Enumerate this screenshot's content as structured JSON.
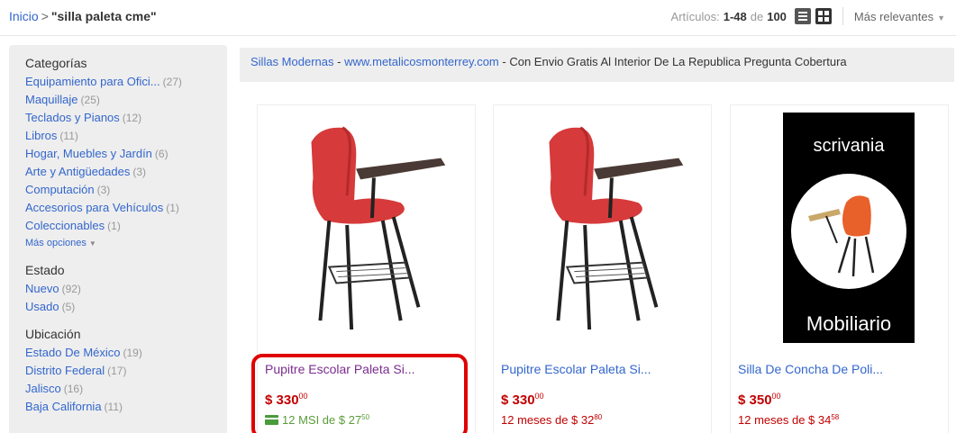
{
  "breadcrumb": {
    "home": "Inicio",
    "separator": ">",
    "query": "\"silla paleta cme\""
  },
  "results": {
    "prefix": "Artículos:",
    "range": "1-48",
    "de": "de",
    "total": "100",
    "sort_label": "Más relevantes"
  },
  "sidebar": {
    "categories": {
      "heading": "Categorías",
      "items": [
        {
          "label": "Equipamiento para Ofici...",
          "count": "(27)"
        },
        {
          "label": "Maquillaje",
          "count": "(25)"
        },
        {
          "label": "Teclados y Pianos",
          "count": "(12)"
        },
        {
          "label": "Libros",
          "count": "(11)"
        },
        {
          "label": "Hogar, Muebles y Jardín",
          "count": "(6)"
        },
        {
          "label": "Arte y Antigüedades",
          "count": "(3)"
        },
        {
          "label": "Computación",
          "count": "(3)"
        },
        {
          "label": "Accesorios para Vehículos",
          "count": "(1)"
        },
        {
          "label": "Coleccionables",
          "count": "(1)"
        }
      ],
      "more": "Más opciones"
    },
    "condition": {
      "heading": "Estado",
      "items": [
        {
          "label": "Nuevo",
          "count": "(92)"
        },
        {
          "label": "Usado",
          "count": "(5)"
        }
      ]
    },
    "location": {
      "heading": "Ubicación",
      "items": [
        {
          "label": "Estado De México",
          "count": "(19)"
        },
        {
          "label": "Distrito Federal",
          "count": "(17)"
        },
        {
          "label": "Jalisco",
          "count": "(16)"
        },
        {
          "label": "Baja California",
          "count": "(11)"
        }
      ]
    }
  },
  "ad": {
    "title": "Sillas Modernas",
    "dash1": " - ",
    "url": "www.metalicosmonterrey.com",
    "dash2": " - ",
    "description": "Con Envio Gratis Al Interior De La Republica Pregunta Cobertura"
  },
  "products": [
    {
      "title": "Pupitre Escolar Paleta Si...",
      "currency": "$",
      "price": "330",
      "cents": "00",
      "installment_text": "12 MSI de $ 27",
      "installment_cents": "50",
      "installment_style": "msi"
    },
    {
      "title": "Pupitre Escolar Paleta Si...",
      "currency": "$",
      "price": "330",
      "cents": "00",
      "installment_text": "12 meses de $ 32",
      "installment_cents": "80",
      "installment_style": "regular"
    },
    {
      "title": "Silla De Concha De Poli...",
      "currency": "$",
      "price": "350",
      "cents": "00",
      "installment_text": "12 meses de $ 34",
      "installment_cents": "58",
      "installment_style": "regular",
      "image_text_top": "scrivania",
      "image_text_bottom": "Mobiliario"
    }
  ],
  "colors": {
    "link": "#3366cc",
    "visited": "#7b2d8e",
    "price": "#c20000",
    "msi_green": "#5a9d3a",
    "highlight": "#e00000",
    "chair_red": "#d63a3a"
  },
  "icons": [
    "list-view-icon",
    "grid-view-icon",
    "chevron-down-icon",
    "card-payment-icon"
  ]
}
